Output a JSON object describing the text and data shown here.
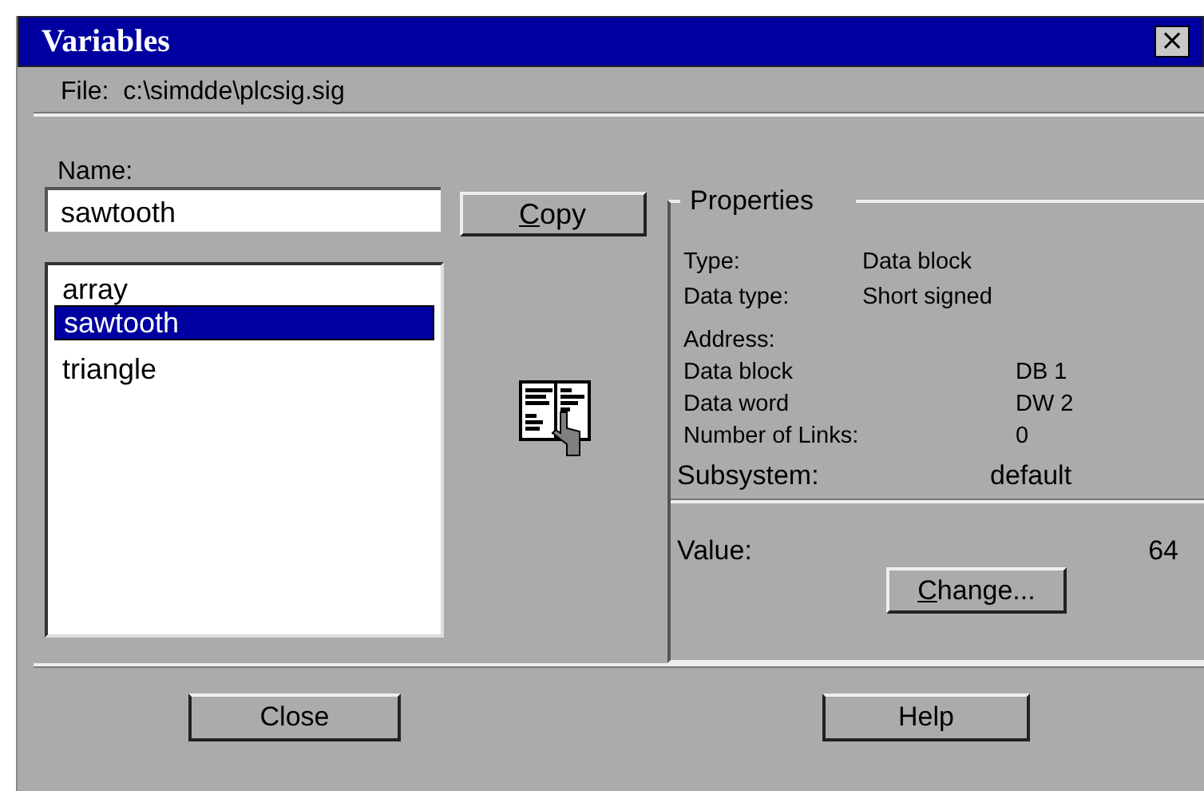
{
  "window": {
    "title": "Variables",
    "close": "×"
  },
  "file": "File:  c:\\simdde\\plcsig.sig",
  "name_field": {
    "label": "Name:",
    "value": "sawtooth"
  },
  "variables": [
    {
      "label": "array",
      "selected": false
    },
    {
      "label": "sawtooth",
      "selected": true
    },
    {
      "label": "triangle",
      "selected": false
    }
  ],
  "copy_button": {
    "mnemonic": "C",
    "rest": "opy"
  },
  "properties": {
    "title": "Properties",
    "type_rows": [
      {
        "label": "Type:",
        "value": "Data block"
      },
      {
        "label": "Data type:",
        "value": "Short signed"
      }
    ],
    "address_title": "Address:",
    "address_rows": [
      {
        "label": "Data block",
        "value": "DB 1"
      },
      {
        "label": "Data word",
        "value": "DW 2"
      },
      {
        "label": "Number of Links:",
        "value": "0"
      }
    ],
    "subsystem": {
      "label": "Subsystem:",
      "value": "default"
    },
    "value": {
      "label": "Value:",
      "value": "64"
    },
    "change_button": {
      "mnemonic": "C",
      "rest": "hange..."
    }
  },
  "buttons": [
    "Close",
    "Help"
  ]
}
